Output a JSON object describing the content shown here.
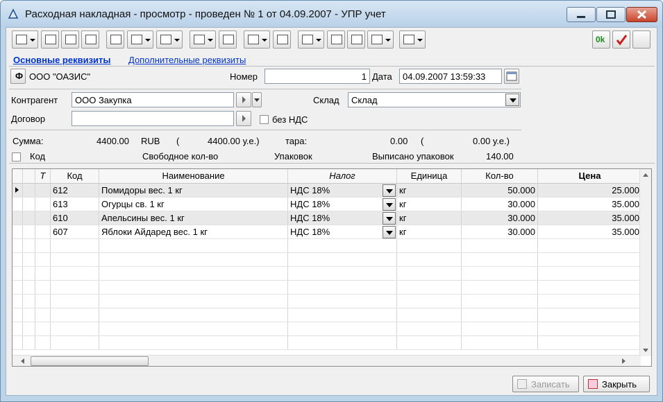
{
  "window": {
    "title": "Расходная накладная - просмотр - проведен № 1 от 04.09.2007 - УПР учет"
  },
  "tabs": {
    "main": "Основные реквизиты",
    "extra": "Дополнительные реквизиты"
  },
  "header": {
    "org_button": "Ф",
    "org": "ООО \"ОАЗИС\"",
    "number_label": "Номер",
    "number": "1",
    "date_label": "Дата",
    "date": "04.09.2007 13:59:33"
  },
  "form": {
    "counterparty_label": "Контрагент",
    "counterparty": "ООО Закупка",
    "warehouse_label": "Склад",
    "warehouse": "Склад",
    "contract_label": "Договор",
    "contract": "",
    "no_vat_label": "без НДС"
  },
  "summary": {
    "sum_label": "Сумма:",
    "sum": "4400.00",
    "currency": "RUB",
    "open_paren": "(",
    "sum_ue": "4400.00 у.е.)",
    "tara_label": "тара:",
    "tara": "0.00",
    "open_paren2": "(",
    "tara_ue": "0.00 у.е.)",
    "code_label": "Код",
    "free_qty_label": "Свободное кол-во",
    "pack_label": "Упаковок",
    "written_pack_label": "Выписано упаковок",
    "written_pack": "140.00"
  },
  "table": {
    "columns": [
      "T",
      "Код",
      "Наименование",
      "Налог",
      "Единица",
      "Кол-во",
      "Цена"
    ],
    "rows": [
      {
        "code": "612",
        "name": "Помидоры вес. 1 кг",
        "tax": "НДС 18%",
        "unit": "кг",
        "qty": "50.000",
        "price": "25.000"
      },
      {
        "code": "613",
        "name": "Огурцы св. 1 кг",
        "tax": "НДС 18%",
        "unit": "кг",
        "qty": "30.000",
        "price": "35.000"
      },
      {
        "code": "610",
        "name": "Апельсины вес. 1 кг",
        "tax": "НДС 18%",
        "unit": "кг",
        "qty": "30.000",
        "price": "35.000"
      },
      {
        "code": "607",
        "name": "Яблоки Айдаред вес. 1 кг",
        "tax": "НДС 18%",
        "unit": "кг",
        "qty": "30.000",
        "price": "35.000"
      }
    ]
  },
  "toolbar": {
    "ok_label": "0k"
  },
  "buttons": {
    "save": "Записать",
    "close": "Закрыть"
  }
}
